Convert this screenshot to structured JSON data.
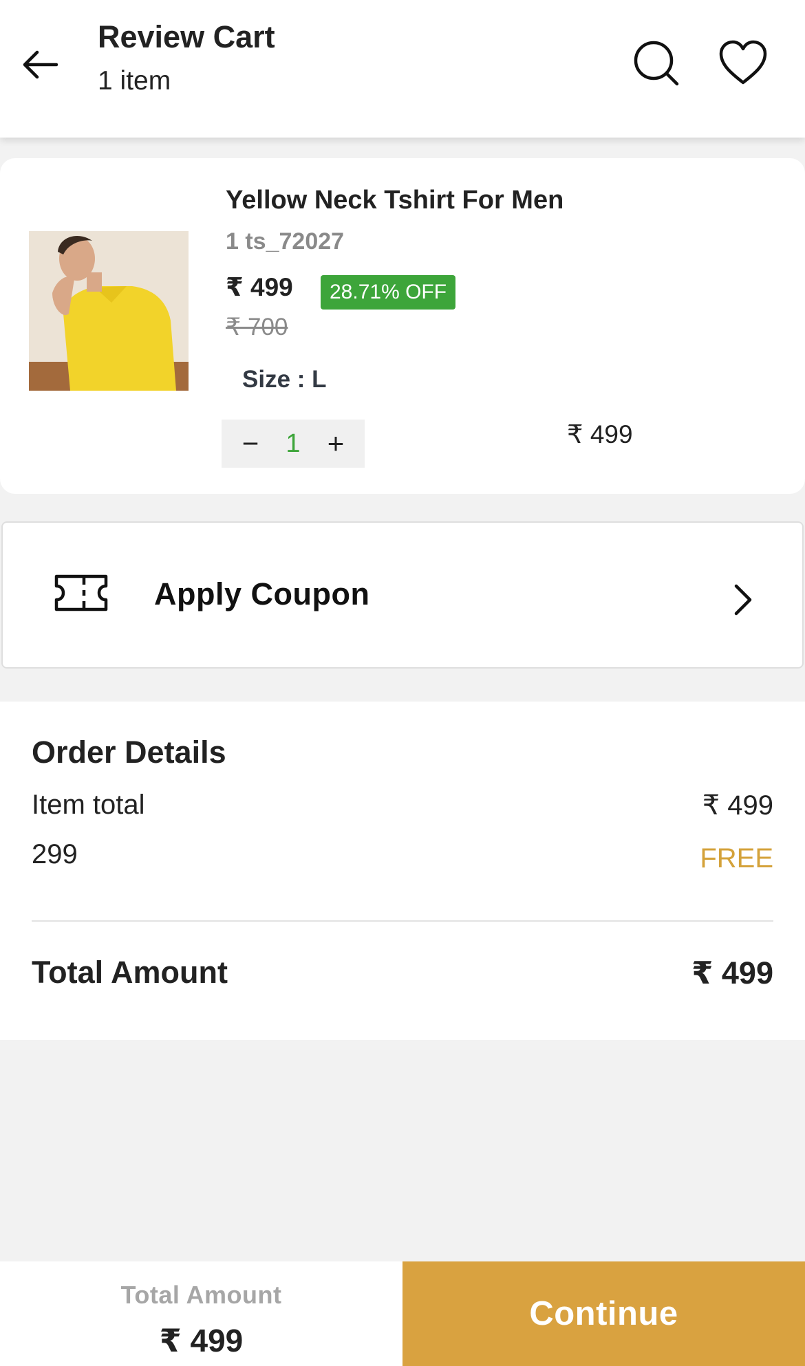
{
  "header": {
    "title": "Review Cart",
    "subtitle": "1 item",
    "icons": [
      "back-arrow-icon",
      "search-icon",
      "heart-icon"
    ]
  },
  "cart_item": {
    "name": "Yellow Neck Tshirt For Men",
    "sku": "1 ts_72027",
    "price": "₹ 499",
    "discount": "28.71% OFF",
    "mrp": "₹ 700",
    "size": "Size : L",
    "qty_minus": "−",
    "quantity": "1",
    "qty_plus": "+",
    "line_total": "₹ 499"
  },
  "coupon": {
    "label": "Apply Coupon",
    "icon": "coupon-ticket-icon"
  },
  "order_details": {
    "title": "Order Details",
    "rows": [
      {
        "label": "Item total",
        "value": "₹ 499"
      },
      {
        "label": "299",
        "value": "FREE"
      }
    ],
    "total_label": "Total Amount",
    "total_value": "₹ 499"
  },
  "bottom_bar": {
    "label": "Total Amount",
    "amount": "₹ 499",
    "continue_label": "Continue"
  },
  "colors": {
    "accent": "#d9a240",
    "discount_green": "#3da53a",
    "free_text": "#d4a23a"
  }
}
